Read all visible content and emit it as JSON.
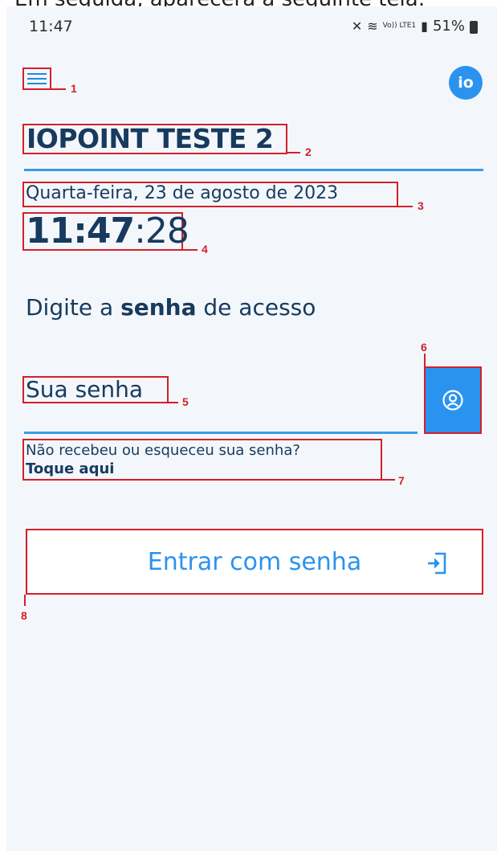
{
  "caption": "Em seguida, aparecerá a seguinte tela:",
  "status": {
    "time": "11:47",
    "battery": "51%",
    "network": "Vo)) LTE1"
  },
  "header": {
    "avatar_text": "io"
  },
  "company": {
    "name": "IOPOINT TESTE 2"
  },
  "clock": {
    "date": "Quarta-feira, 23 de agosto de 2023",
    "hm": "11:47",
    "sec": ":28"
  },
  "login": {
    "prompt_pre": "Digite a ",
    "prompt_bold": "senha",
    "prompt_post": " de acesso",
    "password_placeholder": "Sua senha",
    "help_line1": "Não recebeu ou esqueceu sua senha?",
    "help_line2": "Toque aqui",
    "enter_label": "Entrar com senha"
  },
  "annotations": [
    "1",
    "2",
    "3",
    "4",
    "5",
    "6",
    "7",
    "8"
  ],
  "colors": {
    "accent": "#2a93f0",
    "text": "#173a5e",
    "annotation": "#d41f2a"
  },
  "icons": {
    "menu": "hamburger-icon",
    "id": "user-circle-icon",
    "enter": "login-arrow-icon"
  }
}
